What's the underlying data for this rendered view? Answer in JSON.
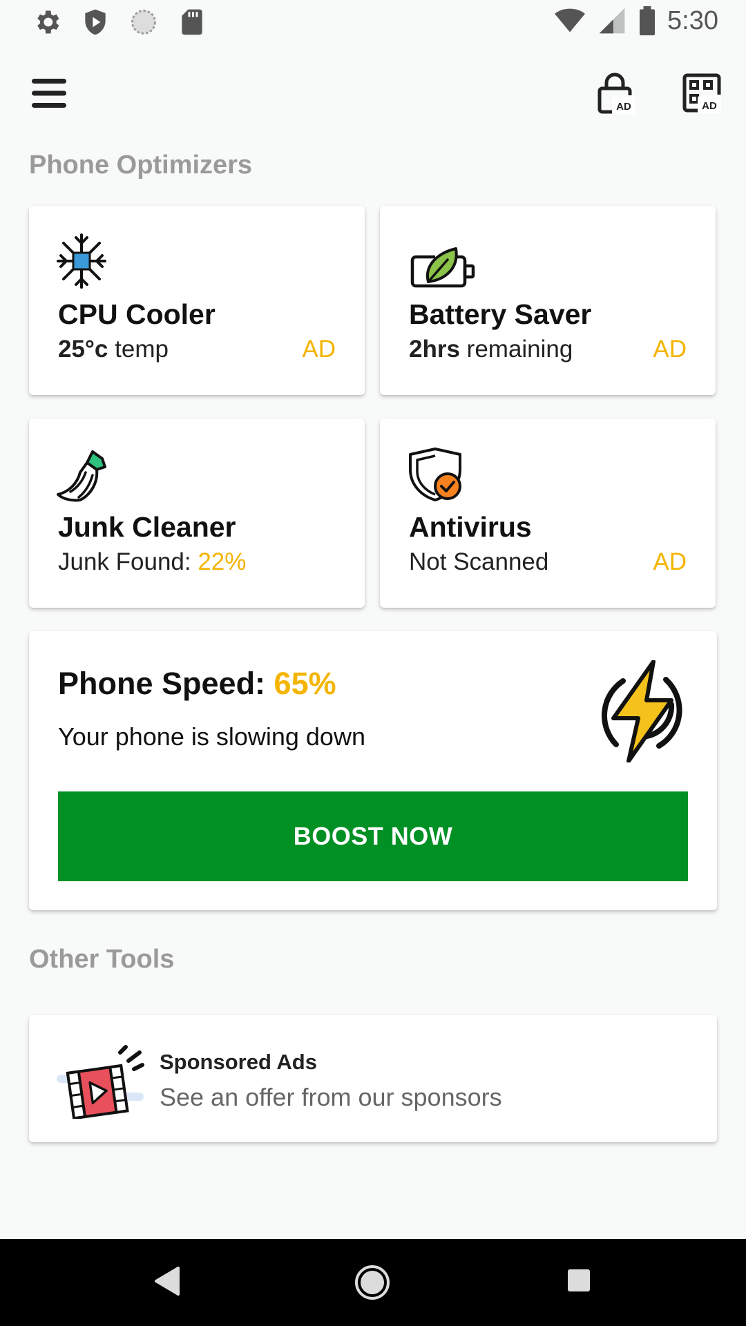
{
  "status_bar": {
    "time": "5:30",
    "left_icons": [
      "settings-icon",
      "shield-icon",
      "sync-icon",
      "sd-card-icon"
    ],
    "right_icons": [
      "wifi-icon",
      "cell-signal-icon",
      "battery-icon"
    ]
  },
  "toolbar": {
    "menu_icon": "hamburger-menu-icon",
    "actions": [
      {
        "icon": "lock-ad-icon",
        "badge": "AD"
      },
      {
        "icon": "qr-ad-icon",
        "badge": "AD"
      }
    ]
  },
  "sections": {
    "optimizers_title": "Phone Optimizers",
    "other_tools_title": "Other Tools"
  },
  "tiles": [
    {
      "icon": "snowflake-cpu-icon",
      "title": "CPU Cooler",
      "value": "25°c",
      "value_suffix": " temp",
      "ad": "AD"
    },
    {
      "icon": "battery-leaf-icon",
      "title": "Battery Saver",
      "value": "2hrs",
      "value_suffix": " remaining",
      "ad": "AD"
    },
    {
      "icon": "broom-icon",
      "title": "Junk Cleaner",
      "label": "Junk Found: ",
      "value": "22%"
    },
    {
      "icon": "shield-check-icon",
      "title": "Antivirus",
      "label": "Not Scanned",
      "ad": "AD"
    }
  ],
  "speed": {
    "label": "Phone Speed: ",
    "value": "65%",
    "description": "Your phone is slowing down",
    "button": "BOOST NOW",
    "icon": "lightning-bolt-icon"
  },
  "sponsored": {
    "icon": "video-ad-icon",
    "title": "Sponsored Ads",
    "description": "See an offer from our sponsors"
  },
  "nav_bar": {
    "buttons": [
      "back-icon",
      "home-icon",
      "recents-icon"
    ]
  },
  "colors": {
    "accent": "#f4b400",
    "boost_green": "#009024",
    "section_title": "#9a9a9a",
    "cpu_blue": "#3a9ad9",
    "leaf_green": "#8bc34a",
    "broom_green": "#2ec27e",
    "antivirus_orange": "#f5821f",
    "video_red": "#e8505b"
  }
}
